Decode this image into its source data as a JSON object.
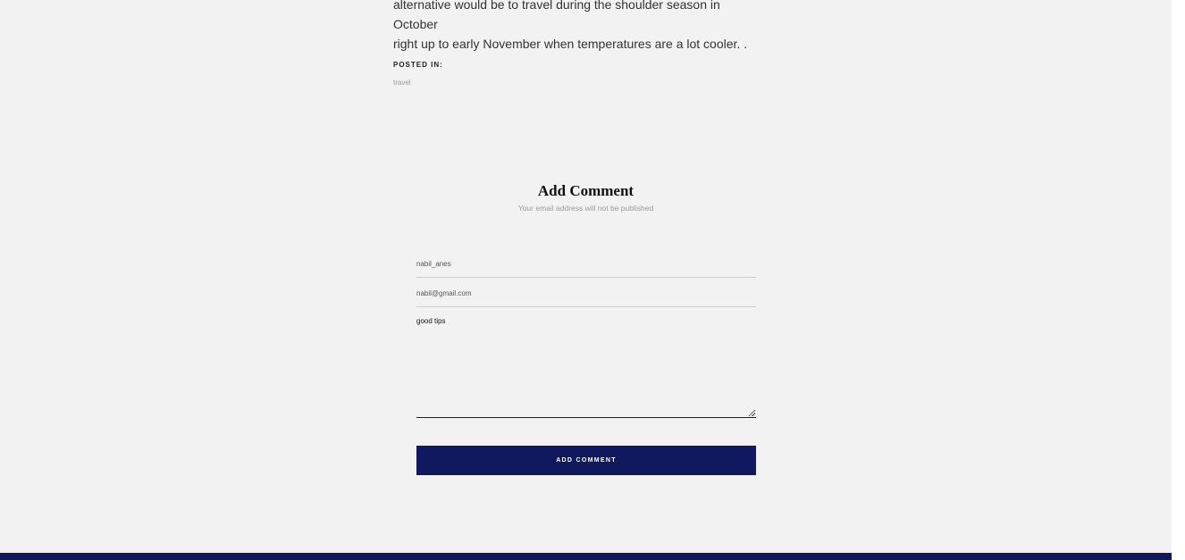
{
  "article": {
    "line1": "alternative would be to travel during the shoulder season in October",
    "line2": "right up to early November when temperatures are a lot cooler. ."
  },
  "meta": {
    "posted_in_label": "POSTED IN:",
    "tag": "travel"
  },
  "comment_section": {
    "title": "Add Comment",
    "subtitle": "Your email address will not be published"
  },
  "form": {
    "name_value": "nabil_anes",
    "email_value": "nabil@gmail.com",
    "comment_value": "good tips",
    "submit_label": "ADD COMMENT"
  },
  "colors": {
    "page_bg": "#f2f2f2",
    "accent_navy": "#11195e"
  },
  "icons": {
    "resize": "resize-grip-icon"
  }
}
